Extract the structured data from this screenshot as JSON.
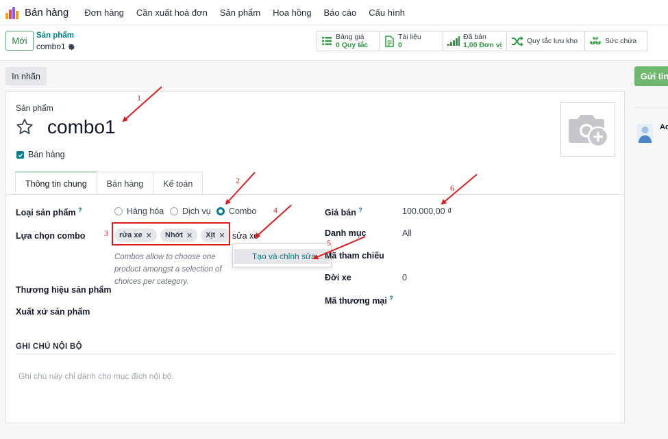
{
  "topnav": {
    "app_name": "Bán hàng",
    "menu": [
      "Đơn hàng",
      "Cần xuất hoá đơn",
      "Sản phẩm",
      "Hoa hồng",
      "Báo cáo",
      "Cấu hình"
    ]
  },
  "control_panel": {
    "new_label": "Mới",
    "breadcrumb_parent": "Sản phẩm",
    "breadcrumb_current": "combo1",
    "smart_buttons": [
      {
        "label": "Bảng giá",
        "value": "0 Quy tắc",
        "icon": "list-icon"
      },
      {
        "label": "Tài liệu",
        "value": "0",
        "icon": "document-icon"
      },
      {
        "label": "Đã bán",
        "value": "1,00 Đơn vị",
        "icon": "bar-chart-icon"
      },
      {
        "label": "Quy tắc lưu kho",
        "value": "",
        "icon": "shuffle-icon"
      },
      {
        "label": "Sức chứa",
        "value": "",
        "icon": "cubes-icon"
      }
    ]
  },
  "actions": {
    "print_label": "In nhãn",
    "send_label": "Gửi tin"
  },
  "form": {
    "product_label": "Sản phẩm",
    "product_name": "combo1",
    "can_be_sold_label": "Bán hàng",
    "tabs": [
      "Thông tin chung",
      "Bán hàng",
      "Kế toán"
    ],
    "product_type_label": "Loại sản phẩm",
    "product_type_options": [
      "Hàng hóa",
      "Dịch vụ",
      "Combo"
    ],
    "product_type_selected": "Combo",
    "combo_label": "Lựa chọn combo",
    "combo_tags": [
      "rửa xe",
      "Nhớt",
      "Xịt"
    ],
    "combo_input_value": "sửa xe",
    "combo_help": "Combos allow to choose one product amongst a selection of choices per category.",
    "dropdown_item": "Tạo và chỉnh sửa...",
    "brand_label": "Thương hiệu sản phẩm",
    "origin_label": "Xuất xứ sản phẩm",
    "sale_price_label": "Giá bán",
    "sale_price": "100.000,00 ₫",
    "category_label": "Danh mục",
    "category": "All",
    "reference_label": "Mã tham chiếu",
    "model_year_label": "Đời xe",
    "model_year": "0",
    "trade_code_label": "Mã thương mại",
    "internal_notes_title": "GHI CHÚ NỘI BỘ",
    "internal_notes_placeholder": "Ghi chú này chỉ dành cho mục đích nội bộ."
  },
  "chatter": {
    "author_initial": "Ad"
  },
  "annotations": [
    "1",
    "2",
    "3",
    "4",
    "5",
    "6"
  ],
  "colors": {
    "accent": "#017e84",
    "green": "#71b86f",
    "annotation_red": "#e01b1b"
  }
}
